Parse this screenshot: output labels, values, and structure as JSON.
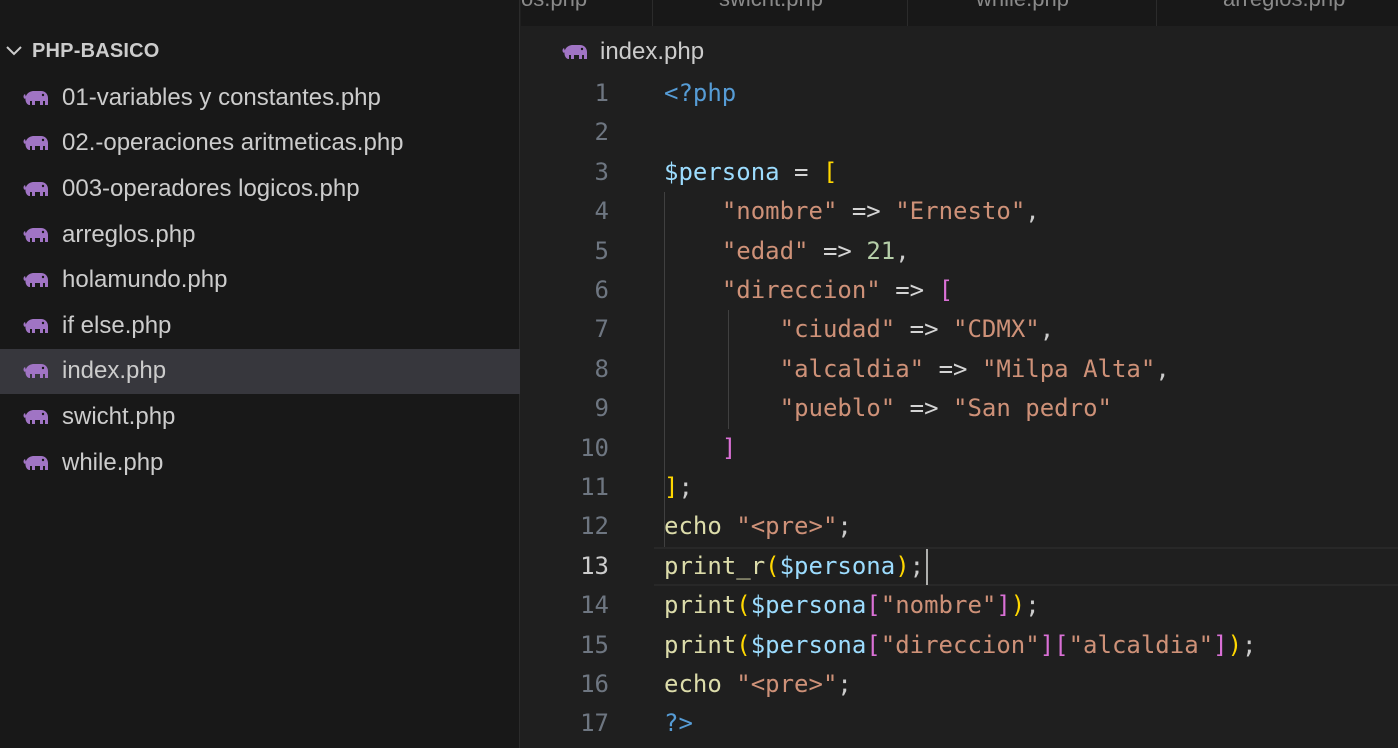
{
  "explorer": {
    "folder_chevron": "❯",
    "folder_name": "PHP-BASICO",
    "files": [
      {
        "name": "01-variables y constantes.php",
        "active": false
      },
      {
        "name": "02.-operaciones aritmeticas.php",
        "active": false
      },
      {
        "name": "003-operadores logicos.php",
        "active": false
      },
      {
        "name": "arreglos.php",
        "active": false
      },
      {
        "name": "holamundo.php",
        "active": false
      },
      {
        "name": "if else.php",
        "active": false
      },
      {
        "name": "index.php",
        "active": true
      },
      {
        "name": "swicht.php",
        "active": false
      },
      {
        "name": "while.php",
        "active": false
      }
    ]
  },
  "tabs": [
    "os.php",
    "swicht.php",
    "while.php",
    "arreglos.php"
  ],
  "breadcrumb": {
    "file": "index.php"
  },
  "editor": {
    "current_line": 13,
    "colors": {
      "keyword": "#569cd6",
      "variable": "#9cdcfe",
      "string": "#ce9178",
      "number": "#b5cea8",
      "function": "#dcdcaa",
      "bracket_gold": "#ffd700",
      "bracket_pink": "#da70d6",
      "bracket_blue": "#179fff"
    },
    "lines": [
      {
        "n": "1",
        "text": "<?php"
      },
      {
        "n": "2",
        "text": ""
      },
      {
        "n": "3",
        "text": "$persona = ["
      },
      {
        "n": "4",
        "text": "    \"nombre\" => \"Ernesto\","
      },
      {
        "n": "5",
        "text": "    \"edad\" => 21,"
      },
      {
        "n": "6",
        "text": "    \"direccion\" => ["
      },
      {
        "n": "7",
        "text": "        \"ciudad\" => \"CDMX\","
      },
      {
        "n": "8",
        "text": "        \"alcaldia\" => \"Milpa Alta\","
      },
      {
        "n": "9",
        "text": "        \"pueblo\" => \"San pedro\""
      },
      {
        "n": "10",
        "text": "    ]"
      },
      {
        "n": "11",
        "text": "];"
      },
      {
        "n": "12",
        "text": "echo \"<pre>\";"
      },
      {
        "n": "13",
        "text": "print_r($persona);"
      },
      {
        "n": "14",
        "text": "print($persona[\"nombre\"]);"
      },
      {
        "n": "15",
        "text": "print($persona[\"direccion\"][\"alcaldia\"]);"
      },
      {
        "n": "16",
        "text": "echo \"<pre>\";"
      },
      {
        "n": "17",
        "text": "?>"
      }
    ]
  }
}
